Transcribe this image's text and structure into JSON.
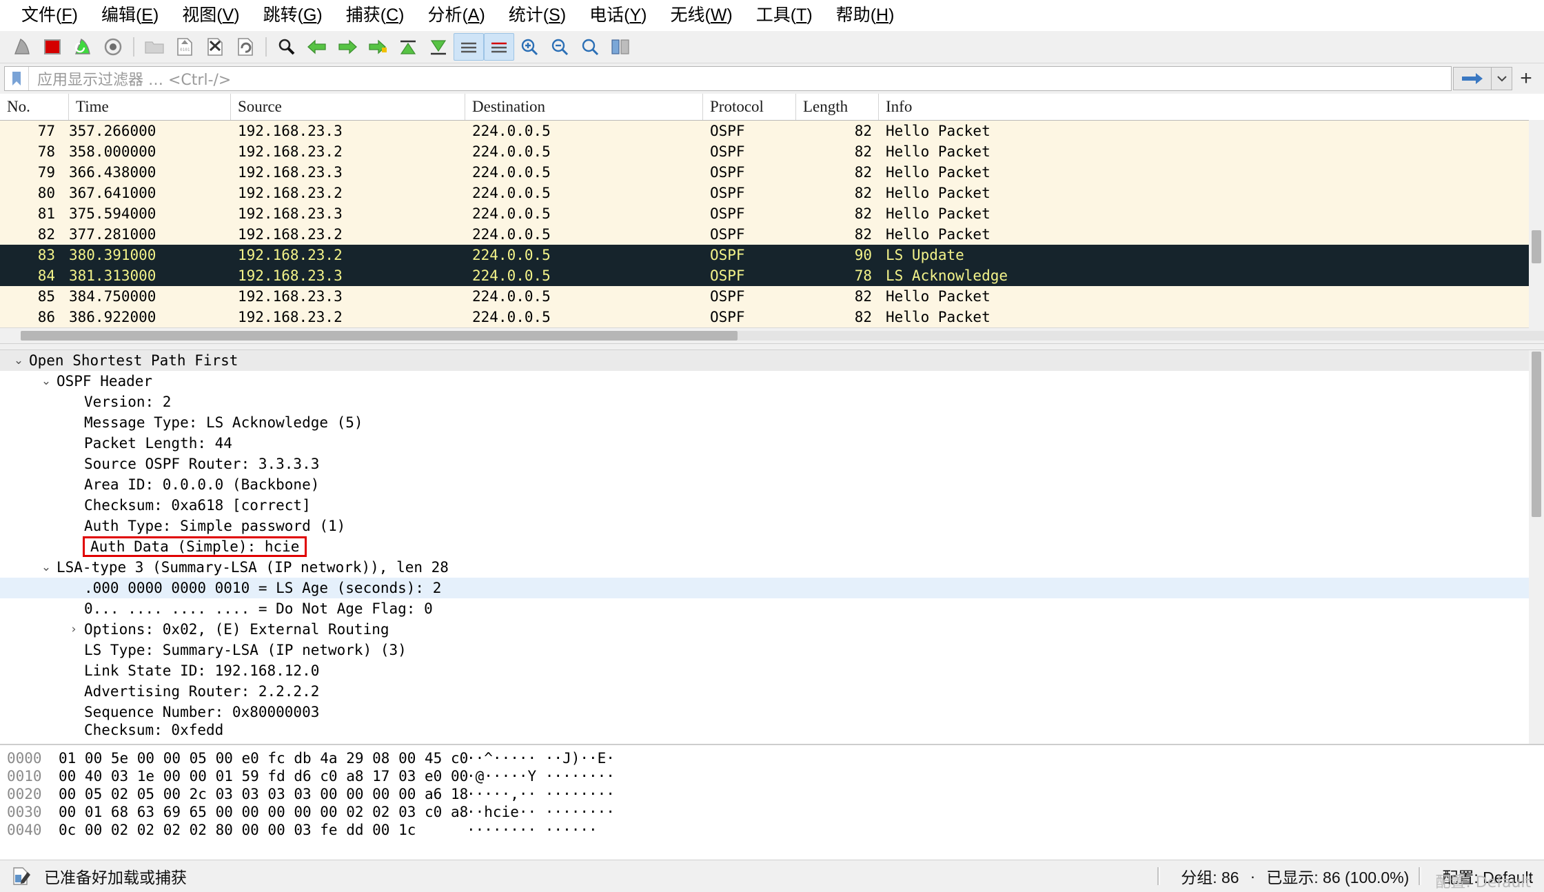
{
  "menu": {
    "items": [
      {
        "label": "文件(F)",
        "accel": "F"
      },
      {
        "label": "编辑(E)",
        "accel": "E"
      },
      {
        "label": "视图(V)",
        "accel": "V"
      },
      {
        "label": "跳转(G)",
        "accel": "G"
      },
      {
        "label": "捕获(C)",
        "accel": "C"
      },
      {
        "label": "分析(A)",
        "accel": "A"
      },
      {
        "label": "统计(S)",
        "accel": "S"
      },
      {
        "label": "电话(Y)",
        "accel": "Y"
      },
      {
        "label": "无线(W)",
        "accel": "W"
      },
      {
        "label": "工具(T)",
        "accel": "T"
      },
      {
        "label": "帮助(H)",
        "accel": "H"
      }
    ]
  },
  "toolbar": {
    "buttons": [
      {
        "name": "start-capture-icon",
        "title": "开始捕获"
      },
      {
        "name": "stop-capture-icon",
        "title": "停止捕获"
      },
      {
        "name": "restart-capture-icon",
        "title": "重新开始捕获"
      },
      {
        "name": "capture-options-icon",
        "title": "捕获选项"
      },
      {
        "name": "open-file-icon",
        "title": "打开"
      },
      {
        "name": "save-file-icon",
        "title": "保存"
      },
      {
        "name": "close-file-icon",
        "title": "关闭"
      },
      {
        "name": "reload-file-icon",
        "title": "重新载入"
      },
      {
        "name": "find-packet-icon",
        "title": "查找分组"
      },
      {
        "name": "go-back-icon",
        "title": "上一个"
      },
      {
        "name": "go-forward-icon",
        "title": "下一个"
      },
      {
        "name": "go-to-packet-icon",
        "title": "跳转到分组"
      },
      {
        "name": "go-first-packet-icon",
        "title": "第一个分组"
      },
      {
        "name": "go-last-packet-icon",
        "title": "最后一个分组"
      },
      {
        "name": "autoscroll-icon",
        "title": "自动滚动"
      },
      {
        "name": "colorize-icon",
        "title": "着色"
      },
      {
        "name": "zoom-in-icon",
        "title": "放大"
      },
      {
        "name": "zoom-out-icon",
        "title": "缩小"
      },
      {
        "name": "zoom-reset-icon",
        "title": "正常大小"
      },
      {
        "name": "resize-columns-icon",
        "title": "调整列宽"
      }
    ]
  },
  "filter": {
    "placeholder": "应用显示过滤器 … <Ctrl-/>",
    "value": "",
    "bookmark_icon": "bookmark-icon",
    "apply_icon": "apply-filter-arrow-icon",
    "dropdown_icon": "chevron-down-icon",
    "add_icon": "add-filter-button"
  },
  "packet_list": {
    "columns": [
      "No.",
      "Time",
      "Source",
      "Destination",
      "Protocol",
      "Length",
      "Info"
    ],
    "rows": [
      {
        "no": "77",
        "time": "357.266000",
        "src": "192.168.23.3",
        "dst": "224.0.0.5",
        "proto": "OSPF",
        "len": "82",
        "info": "Hello Packet",
        "selected": false
      },
      {
        "no": "78",
        "time": "358.000000",
        "src": "192.168.23.2",
        "dst": "224.0.0.5",
        "proto": "OSPF",
        "len": "82",
        "info": "Hello Packet",
        "selected": false
      },
      {
        "no": "79",
        "time": "366.438000",
        "src": "192.168.23.3",
        "dst": "224.0.0.5",
        "proto": "OSPF",
        "len": "82",
        "info": "Hello Packet",
        "selected": false
      },
      {
        "no": "80",
        "time": "367.641000",
        "src": "192.168.23.2",
        "dst": "224.0.0.5",
        "proto": "OSPF",
        "len": "82",
        "info": "Hello Packet",
        "selected": false
      },
      {
        "no": "81",
        "time": "375.594000",
        "src": "192.168.23.3",
        "dst": "224.0.0.5",
        "proto": "OSPF",
        "len": "82",
        "info": "Hello Packet",
        "selected": false
      },
      {
        "no": "82",
        "time": "377.281000",
        "src": "192.168.23.2",
        "dst": "224.0.0.5",
        "proto": "OSPF",
        "len": "82",
        "info": "Hello Packet",
        "selected": false
      },
      {
        "no": "83",
        "time": "380.391000",
        "src": "192.168.23.2",
        "dst": "224.0.0.5",
        "proto": "OSPF",
        "len": "90",
        "info": "LS Update",
        "selected": true
      },
      {
        "no": "84",
        "time": "381.313000",
        "src": "192.168.23.3",
        "dst": "224.0.0.5",
        "proto": "OSPF",
        "len": "78",
        "info": "LS Acknowledge",
        "selected": true
      },
      {
        "no": "85",
        "time": "384.750000",
        "src": "192.168.23.3",
        "dst": "224.0.0.5",
        "proto": "OSPF",
        "len": "82",
        "info": "Hello Packet",
        "selected": false
      },
      {
        "no": "86",
        "time": "386.922000",
        "src": "192.168.23.2",
        "dst": "224.0.0.5",
        "proto": "OSPF",
        "len": "82",
        "info": "Hello Packet",
        "selected": false
      }
    ]
  },
  "detail_tree": {
    "rows": [
      {
        "indent": 0,
        "twisty": "expanded",
        "text": "Open Shortest Path First",
        "highlight": "gray"
      },
      {
        "indent": 1,
        "twisty": "expanded",
        "text": "OSPF Header",
        "highlight": "none"
      },
      {
        "indent": 2,
        "twisty": "none",
        "text": "Version: 2",
        "highlight": "none"
      },
      {
        "indent": 2,
        "twisty": "none",
        "text": "Message Type: LS Acknowledge (5)",
        "highlight": "none"
      },
      {
        "indent": 2,
        "twisty": "none",
        "text": "Packet Length: 44",
        "highlight": "none"
      },
      {
        "indent": 2,
        "twisty": "none",
        "text": "Source OSPF Router: 3.3.3.3",
        "highlight": "none"
      },
      {
        "indent": 2,
        "twisty": "none",
        "text": "Area ID: 0.0.0.0 (Backbone)",
        "highlight": "none"
      },
      {
        "indent": 2,
        "twisty": "none",
        "text": "Checksum: 0xa618 [correct]",
        "highlight": "none"
      },
      {
        "indent": 2,
        "twisty": "none",
        "text": "Auth Type: Simple password (1)",
        "highlight": "none"
      },
      {
        "indent": 2,
        "twisty": "none",
        "text": "Auth Data (Simple): hcie",
        "highlight": "none",
        "boxed": true
      },
      {
        "indent": 1,
        "twisty": "expanded",
        "text": "LSA-type 3 (Summary-LSA (IP network)), len 28",
        "highlight": "none"
      },
      {
        "indent": 2,
        "twisty": "none",
        "text": ".000 0000 0000 0010 = LS Age (seconds): 2",
        "highlight": "blue"
      },
      {
        "indent": 2,
        "twisty": "none",
        "text": "0... .... .... .... = Do Not Age Flag: 0",
        "highlight": "none"
      },
      {
        "indent": 2,
        "twisty": "collapsed",
        "text": "Options: 0x02, (E) External Routing",
        "highlight": "none"
      },
      {
        "indent": 2,
        "twisty": "none",
        "text": "LS Type: Summary-LSA (IP network) (3)",
        "highlight": "none"
      },
      {
        "indent": 2,
        "twisty": "none",
        "text": "Link State ID: 192.168.12.0",
        "highlight": "none"
      },
      {
        "indent": 2,
        "twisty": "none",
        "text": "Advertising Router: 2.2.2.2",
        "highlight": "none"
      },
      {
        "indent": 2,
        "twisty": "none",
        "text": "Sequence Number: 0x80000003",
        "highlight": "none"
      },
      {
        "indent": 2,
        "twisty": "none",
        "text": "Checksum: 0xfedd",
        "highlight": "none",
        "clipped": true
      }
    ],
    "highlight_box_color": "#e00000"
  },
  "hex_dump": {
    "rows": [
      {
        "offset": "0000",
        "bytes": "01 00 5e 00 00 05 00 e0  fc db 4a 29 08 00 45 c0",
        "ascii": "··^····· ··J)··E·"
      },
      {
        "offset": "0010",
        "bytes": "00 40 03 1e 00 00 01 59  fd d6 c0 a8 17 03 e0 00",
        "ascii": "·@·····Y ········"
      },
      {
        "offset": "0020",
        "bytes": "00 05 02 05 00 2c 03 03  03 03 00 00 00 00 a6 18",
        "ascii": "·····,·· ········"
      },
      {
        "offset": "0030",
        "bytes": "00 01 68 63 69 65 00 00  00 00 00 02 02 03 c0 a8",
        "ascii": "··hcie·· ········"
      },
      {
        "offset": "0040",
        "bytes": "0c 00 02 02 02 02 80 00  00 03 fe dd 00 1c",
        "ascii": "········ ······"
      }
    ]
  },
  "status_bar": {
    "icon": "capture-file-properties-icon",
    "message": "已准备好加载或捕获",
    "packets_label": "分组: 86",
    "separator_dot": "·",
    "displayed_label": "已显示: 86 (100.0%)",
    "profile_label": "配置: Default",
    "watermark": "配置: Default"
  }
}
